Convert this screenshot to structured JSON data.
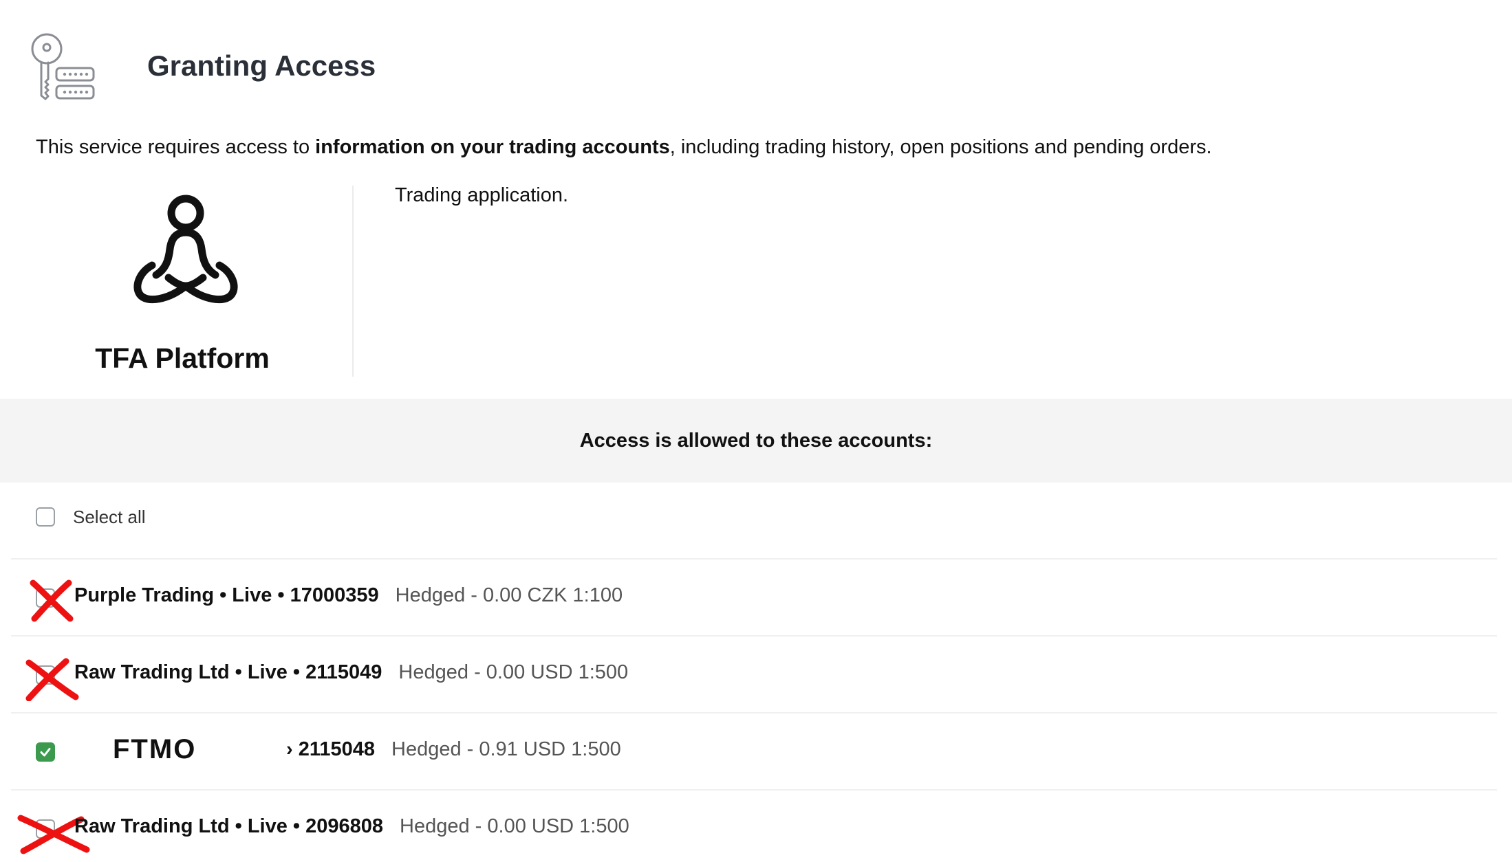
{
  "header": {
    "title": "Granting Access",
    "icon": "key-server-icon"
  },
  "intro": {
    "prefix": "This service requires access to ",
    "bold": "information on your trading accounts",
    "suffix": ", including trading history, open positions and pending orders."
  },
  "app": {
    "name": "TFA Platform",
    "logo_icon": "meditation-person-icon",
    "description": "Trading application."
  },
  "banner": {
    "text": "Access is allowed to these accounts:"
  },
  "select_all": {
    "label": "Select all",
    "checked": false
  },
  "accounts": [
    {
      "name": "Purple Trading • Live • 17000359",
      "details": "Hedged - 0.00 CZK 1:100",
      "checked": false,
      "crossed_out": true
    },
    {
      "name": "Raw Trading Ltd • Live • 2115049",
      "details": "Hedged - 0.00 USD 1:500",
      "checked": false,
      "crossed_out": true
    },
    {
      "logo_text": "FTMO",
      "name": "› 2115048",
      "details": "Hedged - 0.91 USD 1:500",
      "checked": true,
      "crossed_out": false
    },
    {
      "name": "Raw Trading Ltd • Live • 2096808",
      "details": "Hedged - 0.00 USD 1:500",
      "checked": false,
      "crossed_out": true
    }
  ],
  "colors": {
    "title": "#2a2f38",
    "banner_bg": "#f4f4f4",
    "check_green": "#3c9a4e",
    "cross_red": "#ee1111",
    "muted_text": "#555555"
  }
}
